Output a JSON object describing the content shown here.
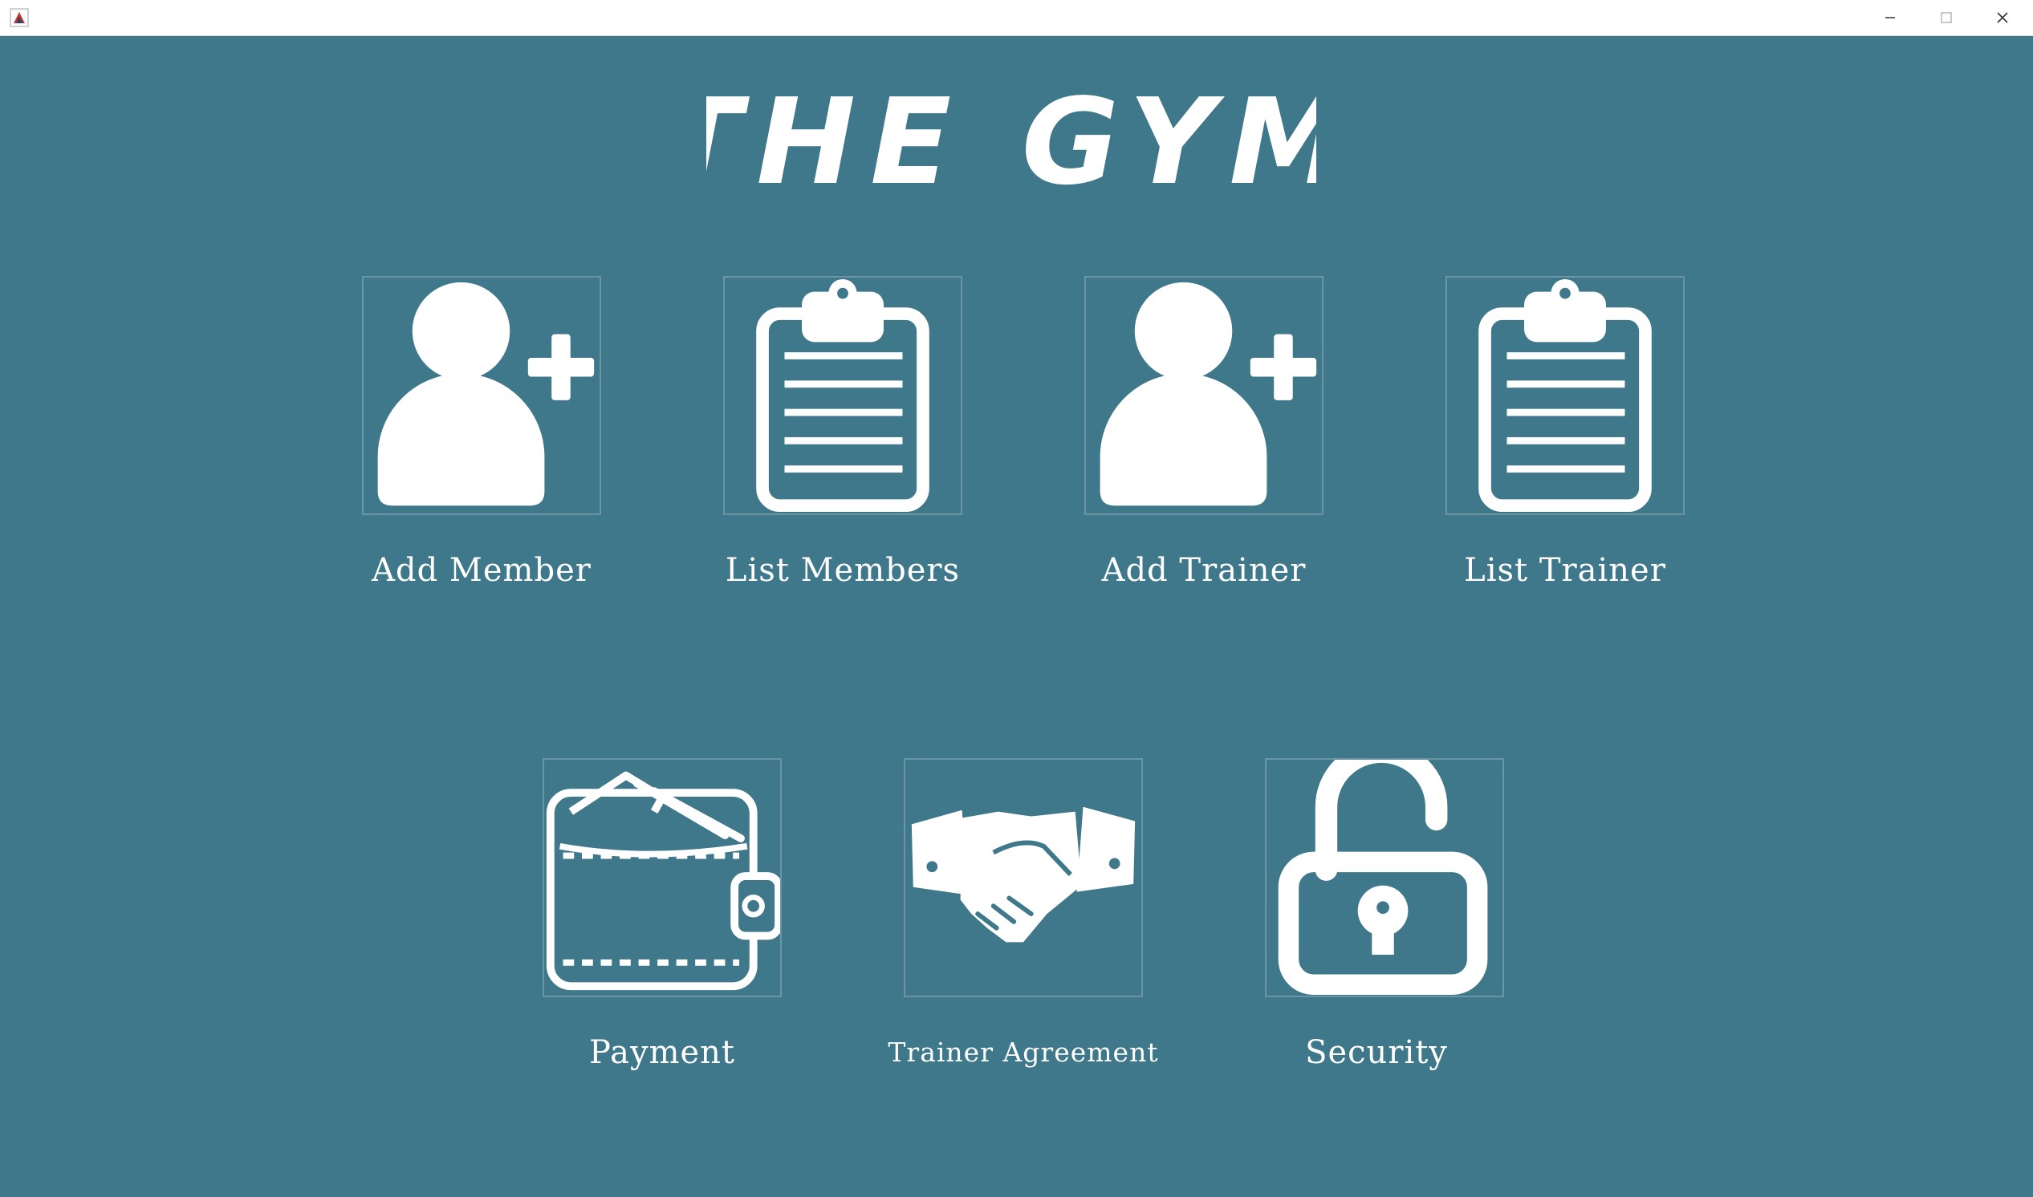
{
  "window": {
    "app_icon": "java-app-icon",
    "controls": [
      "minimize-icon",
      "maximize-icon",
      "close-icon"
    ]
  },
  "logo": {
    "text": "THE GYM"
  },
  "tiles": [
    {
      "label": "Add Member",
      "icon": "add-user-icon"
    },
    {
      "label": "List Members",
      "icon": "clipboard-icon"
    },
    {
      "label": "Add Trainer",
      "icon": "add-user-icon"
    },
    {
      "label": "List Trainer",
      "icon": "clipboard-icon"
    },
    {
      "label": "Payment",
      "icon": "wallet-icon"
    },
    {
      "label": "Trainer Agreement",
      "icon": "handshake-icon"
    },
    {
      "label": "Security",
      "icon": "unlocked-padlock-icon"
    }
  ],
  "colors": {
    "background": "#3f788a",
    "foreground": "#ffffff",
    "tile_border": "#6b95a3"
  }
}
